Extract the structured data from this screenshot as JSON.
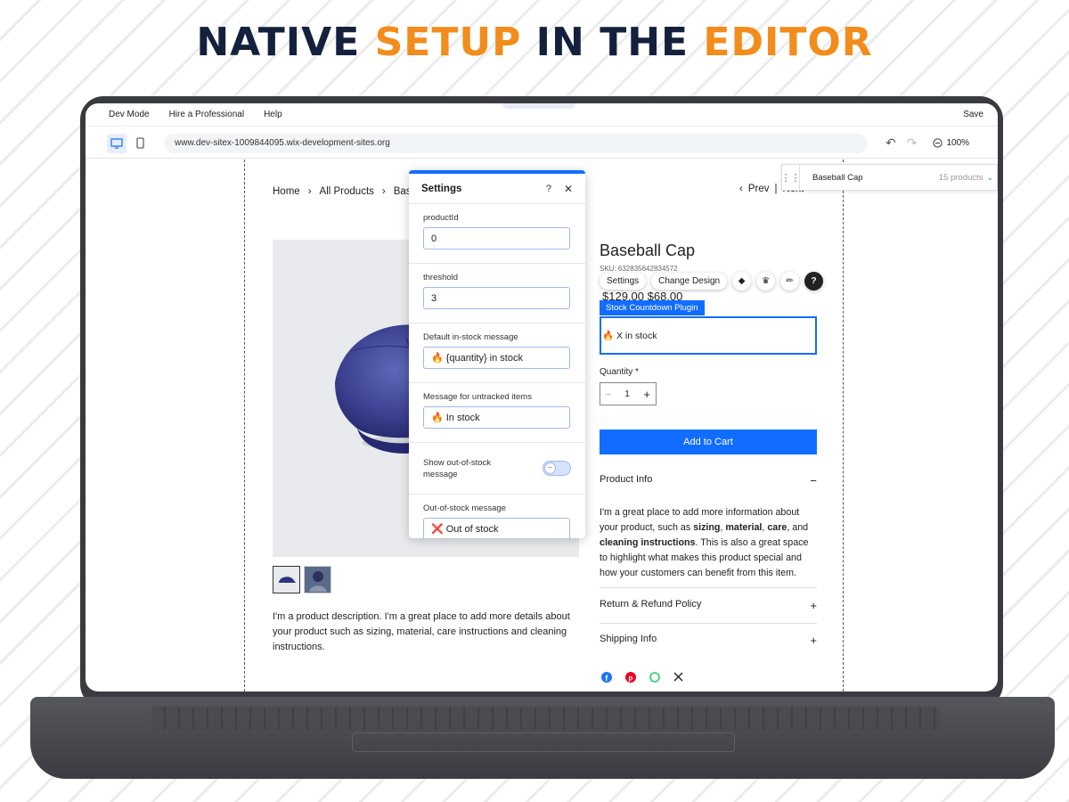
{
  "headline": {
    "part1": "NATIVE ",
    "part2": "SETUP",
    "part3": " IN THE ",
    "part4": "EDITOR"
  },
  "menu": {
    "items": [
      "Dev Mode",
      "Hire a Professional",
      "Help"
    ],
    "save": "Save"
  },
  "toolbar": {
    "url": "www.dev-sitex-1009844095.wix-development-sites.org",
    "zoom": "100%"
  },
  "breadcrumb": {
    "home": "Home",
    "all_products": "All Products",
    "current": "Base"
  },
  "nav": {
    "prev": "Prev",
    "next": "Next"
  },
  "settings_panel": {
    "title": "Settings",
    "help": "?",
    "fields": [
      {
        "label": "productId",
        "value": "0"
      },
      {
        "label": "threshold",
        "value": "3"
      },
      {
        "label": "Default in-stock message",
        "value": "🔥 {quantity} in stock"
      },
      {
        "label": "Message for untracked items",
        "value": "🔥 In stock"
      }
    ],
    "toggle": {
      "label": "Show out-of-stock message",
      "on": false
    },
    "last_field": {
      "label": "Out-of-stock message",
      "value": "❌ Out of stock"
    }
  },
  "product": {
    "title": "Baseball Cap",
    "sku": "SKU: 632835642834572",
    "price": "$129.00  $68.00",
    "description": "I'm a product description. I'm a great place to add more details about your product such as sizing, material, care instructions and cleaning instructions.",
    "quantity_label": "Quantity *",
    "quantity": "1",
    "add_to_cart": "Add to Cart"
  },
  "floating_toolbar": {
    "settings": "Settings",
    "change_design": "Change Design"
  },
  "plugin": {
    "tag": "Stock Countdown Plugin",
    "message": "🔥 X in stock"
  },
  "sections": {
    "product_info": "Product Info",
    "info_parts": [
      "I'm a great place to add more information about your product, such as ",
      "sizing",
      ", ",
      "material",
      ", ",
      "care",
      ", and ",
      "cleaning instructions",
      ". This is also a great space to highlight what makes this product special and how your customers can benefit from this item."
    ],
    "return_policy": "Return & Refund Policy",
    "shipping": "Shipping Info"
  },
  "picker": {
    "name": "Baseball Cap",
    "count": "15 products"
  },
  "colors": {
    "accent": "#116dff",
    "headline_dark": "#14213d",
    "headline_orange": "#f28c1b"
  }
}
